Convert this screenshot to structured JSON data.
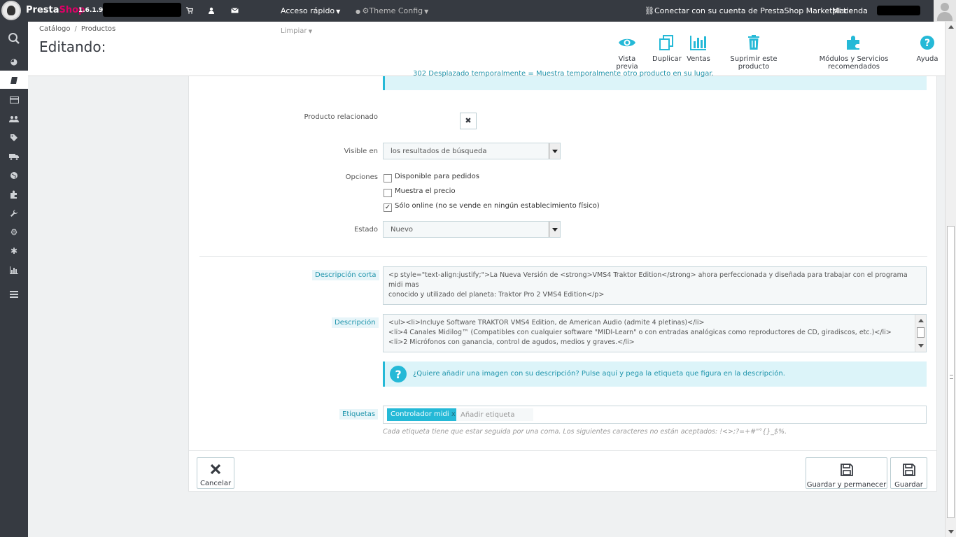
{
  "topbar": {
    "brand_presta": "Presta",
    "brand_shop": "Shop",
    "version": "1.6.1.9",
    "quick_access": "Acceso rápido",
    "theme_config": "Theme Config",
    "clear": "Limpiar",
    "marketplace": "Conectar con su cuenta de PrestaShop Marketplace",
    "my_shop": "Mi tienda"
  },
  "breadcrumb": {
    "catalog": "Catálogo",
    "separator": "/",
    "products": "Productos"
  },
  "page_title": "Editando:",
  "toolbar": {
    "preview": "Vista previa",
    "duplicate": "Duplicar",
    "sales": "Ventas",
    "delete": "Suprimir este producto",
    "modules": "Módulos y Servicios recomendados",
    "help": "Ayuda"
  },
  "form": {
    "redirect_notice": "302 Desplazado temporalmente = Muestra temporalmente otro producto en su lugar.",
    "related_label": "Producto relacionado",
    "visible_label": "Visible en",
    "visible_value": "los resultados de búsqueda",
    "options_label": "Opciones",
    "opt_available": "Disponible para pedidos",
    "opt_show_price": "Muestra el precio",
    "opt_online_only": "Sólo online (no se vende en ningún establecimiento físico)",
    "opt_available_checked": false,
    "opt_show_price_checked": false,
    "opt_online_only_checked": true,
    "state_label": "Estado",
    "state_value": "Nuevo",
    "short_desc_label": "Descripción corta",
    "short_desc_line1": "<p style=\"text-align:justify;\">La Nueva Versión de <strong>VMS4 Traktor Edition</strong> ahora perfeccionada y diseñada para trabajar con el programa midi mas",
    "short_desc_line2": "conocido y utilizado del planeta: Traktor Pro 2 VMS4 Edition</p>",
    "desc_label": "Descripción",
    "desc_line1": "<ul><li>Incluye Software TRAKTOR VMS4 Edition, de American Audio (admite 4 pletinas)</li>",
    "desc_line2": "<li>4 Canales Midilog™ (Compatibles con cualquier software \"MIDI-Learn\" o con entradas analógicas como reproductores de CD, giradiscos, etc.)</li>",
    "desc_line3": "<li>2 Micrófonos con ganancia, control de agudos, medios y graves.</li>",
    "image_notice": "¿Quiere añadir una imagen con su descripción? Pulse aquí y pega la etiqueta que figura en la descripción.",
    "tags_label": "Etiquetas",
    "tag": "Controlador midi",
    "tag_remove": "x",
    "tag_placeholder": "Añadir etiqueta",
    "tags_help": "Cada etiqueta tiene que estar seguida por una coma. Los siguientes caracteres no están aceptados: !<>;?=+#\"°{}_$%."
  },
  "footer_buttons": {
    "cancel": "Cancelar",
    "save_stay": "Guardar y permanecer",
    "save": "Guardar"
  },
  "colors": {
    "accent": "#25b9d7",
    "topbar": "#363a41",
    "brand_pink": "#df0067"
  }
}
